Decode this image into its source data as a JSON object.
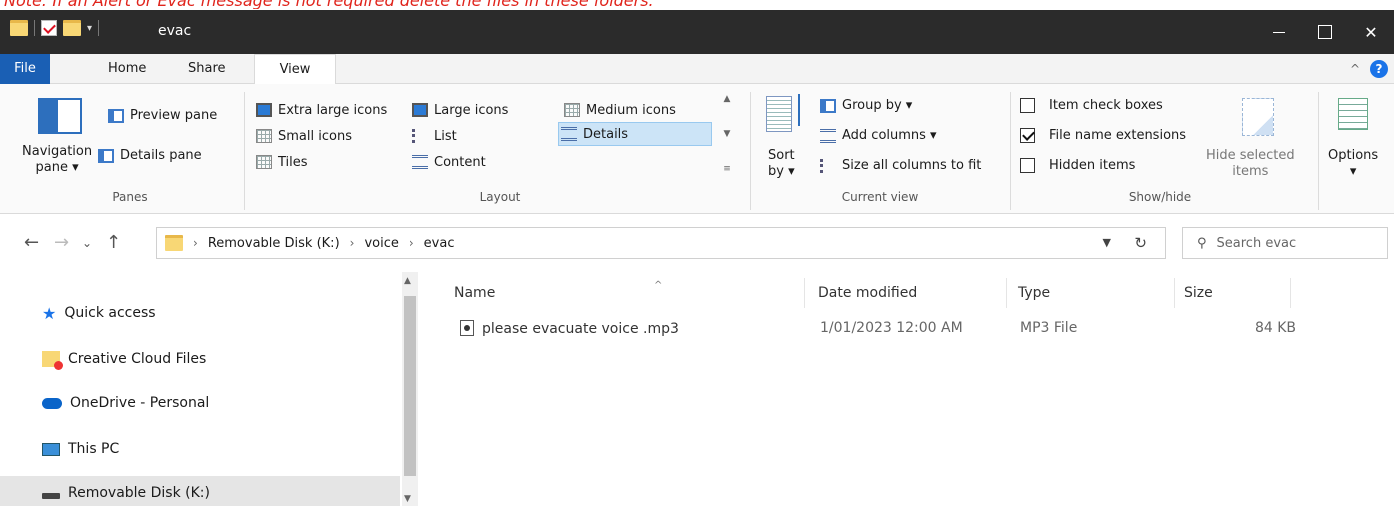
{
  "note": "Note: If an Alert or Evac message is not required delete the files in these folders.",
  "window": {
    "title": "evac",
    "minimize_glyph": "—",
    "close_glyph": "✕",
    "qat_dropdown_glyph": "▾"
  },
  "tabs": {
    "file": "File",
    "home": "Home",
    "share": "Share",
    "view": "View",
    "help_glyph": "?"
  },
  "ribbon": {
    "panes": {
      "label": "Panes",
      "navigation_pane_line1": "Navigation",
      "navigation_pane_line2": "pane ▾",
      "preview_pane": "Preview pane",
      "details_pane": "Details pane"
    },
    "layout": {
      "label": "Layout",
      "extra_large_icons": "Extra large icons",
      "large_icons": "Large icons",
      "medium_icons": "Medium icons",
      "small_icons": "Small icons",
      "list": "List",
      "details": "Details",
      "tiles": "Tiles",
      "content": "Content",
      "selected": "Details"
    },
    "current_view": {
      "label": "Current view",
      "sort_by_line1": "Sort",
      "sort_by_line2": "by ▾",
      "group_by": "Group by ▾",
      "add_columns": "Add columns ▾",
      "size_all_columns": "Size all columns to fit"
    },
    "show_hide": {
      "label": "Show/hide",
      "item_check_boxes": "Item check boxes",
      "item_check_boxes_checked": false,
      "file_name_extensions": "File name extensions",
      "file_name_extensions_checked": true,
      "hidden_items": "Hidden items",
      "hidden_items_checked": false,
      "hide_selected_line1": "Hide selected",
      "hide_selected_line2": "items"
    },
    "options": {
      "label": "Options",
      "dropdown": "▾"
    }
  },
  "address": {
    "breadcrumbs": [
      "Removable Disk (K:)",
      "voice",
      "evac"
    ],
    "separator": "›",
    "search_placeholder": "Search evac"
  },
  "nav_pane": {
    "items": [
      {
        "label": "Quick access",
        "icon": "star-icon"
      },
      {
        "label": "Creative Cloud Files",
        "icon": "creative-cloud-icon"
      },
      {
        "label": "OneDrive - Personal",
        "icon": "onedrive-icon"
      },
      {
        "label": "This PC",
        "icon": "computer-icon"
      },
      {
        "label": "Removable Disk (K:)",
        "icon": "drive-icon",
        "selected": true
      }
    ]
  },
  "file_list": {
    "columns": {
      "name": "Name",
      "date_modified": "Date modified",
      "type": "Type",
      "size": "Size"
    },
    "rows": [
      {
        "name": "please evacuate voice .mp3",
        "date_modified": "1/01/2023 12:00 AM",
        "type": "MP3 File",
        "size": "84 KB"
      }
    ]
  },
  "colors": {
    "accent": "#1a5fb4",
    "note_red": "#e0241c",
    "titlebar": "#2b2b2b",
    "selection": "#cce4f7"
  }
}
